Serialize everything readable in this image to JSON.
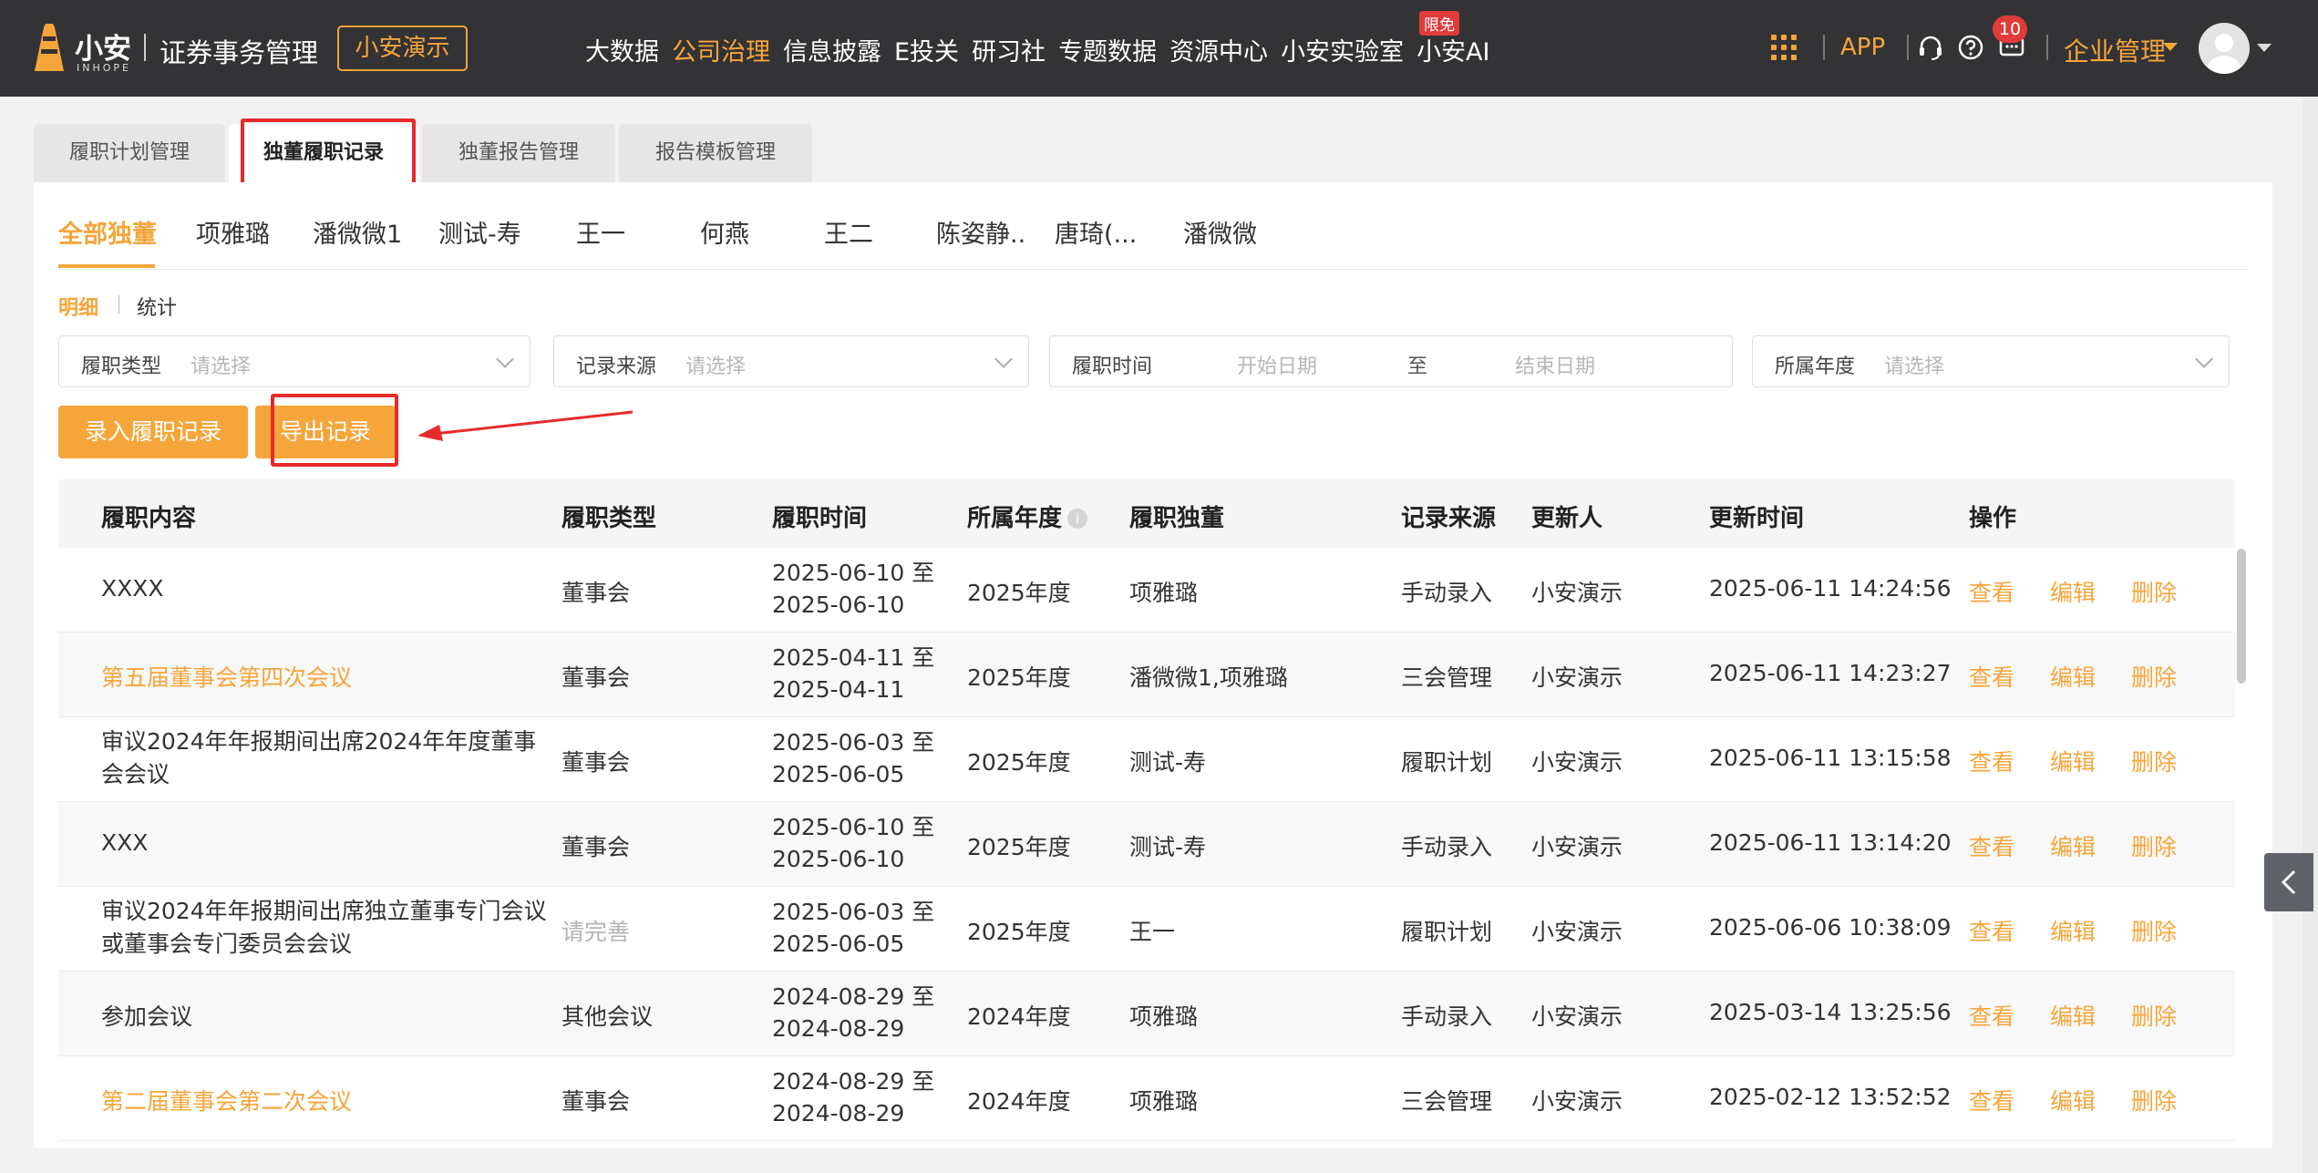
{
  "header": {
    "logo_cn": "小安",
    "logo_en": "INHOPE",
    "system_title": "证券事务管理",
    "company": "小安演示",
    "nav": [
      {
        "label": "大数据",
        "active": false
      },
      {
        "label": "公司治理",
        "active": true
      },
      {
        "label": "信息披露",
        "active": false
      },
      {
        "label": "E投关",
        "active": false
      },
      {
        "label": "研习社",
        "active": false
      },
      {
        "label": "专题数据",
        "active": false
      },
      {
        "label": "资源中心",
        "active": false
      },
      {
        "label": "小安实验室",
        "active": false
      },
      {
        "label": "小安AI",
        "active": false
      }
    ],
    "free_badge": "限免",
    "app_label": "APP",
    "notification_count": "10",
    "enterprise_menu": "企业管理",
    "icons": [
      "apps-grid-icon",
      "headset-icon",
      "help-icon",
      "message-icon",
      "avatar"
    ]
  },
  "page_tabs": [
    {
      "label": "履职计划管理",
      "active": false
    },
    {
      "label": "独董履职记录",
      "active": true
    },
    {
      "label": "独董报告管理",
      "active": false
    },
    {
      "label": "报告模板管理",
      "active": false
    }
  ],
  "director_tabs": [
    {
      "label": "全部独董",
      "active": true
    },
    {
      "label": "项雅璐",
      "active": false
    },
    {
      "label": "潘微微1",
      "active": false
    },
    {
      "label": "测试-寿",
      "active": false
    },
    {
      "label": "王一",
      "active": false
    },
    {
      "label": "何燕",
      "active": false
    },
    {
      "label": "王二",
      "active": false
    },
    {
      "label": "陈姿静..",
      "active": false
    },
    {
      "label": "唐琦(...",
      "active": false
    },
    {
      "label": "潘微微",
      "active": false
    }
  ],
  "view_tabs": {
    "detail": "明细",
    "stats": "统计"
  },
  "filters": {
    "duty_type": {
      "label": "履职类型",
      "placeholder": "请选择"
    },
    "record_source": {
      "label": "记录来源",
      "placeholder": "请选择"
    },
    "duty_time": {
      "label": "履职时间",
      "start_placeholder": "开始日期",
      "to": "至",
      "end_placeholder": "结束日期"
    },
    "year": {
      "label": "所属年度",
      "placeholder": "请选择"
    }
  },
  "buttons": {
    "add_record": "录入履职记录",
    "export_record": "导出记录"
  },
  "table": {
    "columns": [
      "履职内容",
      "履职类型",
      "履职时间",
      "所属年度",
      "履职独董",
      "记录来源",
      "更新人",
      "更新时间",
      "操作"
    ],
    "year_info_icon": "i",
    "actions": {
      "view": "查看",
      "edit": "编辑",
      "delete": "删除"
    },
    "rows": [
      {
        "content": "XXXX",
        "content_link": false,
        "type": "董事会",
        "type_muted": false,
        "start": "2025-06-10 至",
        "end": "2025-06-10",
        "year": "2025年度",
        "director": "项雅璐",
        "source": "手动录入",
        "updater": "小安演示",
        "updated": "2025-06-11 14:24:56"
      },
      {
        "content": "第五届董事会第四次会议",
        "content_link": true,
        "type": "董事会",
        "type_muted": false,
        "start": "2025-04-11 至",
        "end": "2025-04-11",
        "year": "2025年度",
        "director": "潘微微1,项雅璐",
        "source": "三会管理",
        "updater": "小安演示",
        "updated": "2025-06-11 14:23:27"
      },
      {
        "content": "审议2024年年报期间出席2024年年度董事会会议",
        "content_link": false,
        "type": "董事会",
        "type_muted": false,
        "start": "2025-06-03 至",
        "end": "2025-06-05",
        "year": "2025年度",
        "director": "测试-寿",
        "source": "履职计划",
        "updater": "小安演示",
        "updated": "2025-06-11 13:15:58"
      },
      {
        "content": "XXX",
        "content_link": false,
        "type": "董事会",
        "type_muted": false,
        "start": "2025-06-10 至",
        "end": "2025-06-10",
        "year": "2025年度",
        "director": "测试-寿",
        "source": "手动录入",
        "updater": "小安演示",
        "updated": "2025-06-11 13:14:20"
      },
      {
        "content": "审议2024年年报期间出席独立董事专门会议或董事会专门委员会会议",
        "content_link": false,
        "type": "请完善",
        "type_muted": true,
        "start": "2025-06-03 至",
        "end": "2025-06-05",
        "year": "2025年度",
        "director": "王一",
        "source": "履职计划",
        "updater": "小安演示",
        "updated": "2025-06-06 10:38:09"
      },
      {
        "content": "参加会议",
        "content_link": false,
        "type": "其他会议",
        "type_muted": false,
        "start": "2024-08-29 至",
        "end": "2024-08-29",
        "year": "2024年度",
        "director": "项雅璐",
        "source": "手动录入",
        "updater": "小安演示",
        "updated": "2025-03-14 13:25:56"
      },
      {
        "content": "第二届董事会第二次会议",
        "content_link": true,
        "type": "董事会",
        "type_muted": false,
        "start": "2024-08-29 至",
        "end": "2024-08-29",
        "year": "2024年度",
        "director": "项雅璐",
        "source": "三会管理",
        "updater": "小安演示",
        "updated": "2025-02-12 13:52:52"
      }
    ]
  },
  "colors": {
    "accent": "#f6a53a",
    "topbar": "#333336",
    "highlight": "#e82a2a"
  }
}
